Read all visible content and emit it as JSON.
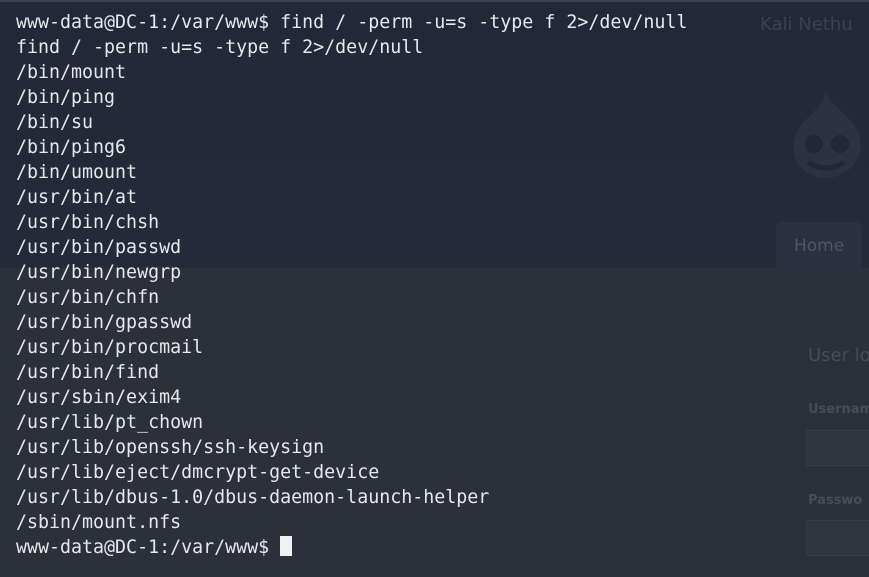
{
  "background": {
    "site_title": "Kali Nethu",
    "tab_label": "Home",
    "login_heading": "User lo",
    "username_label": "Usernam",
    "password_label": "Passwo"
  },
  "terminal": {
    "prompt": "www-data@DC-1:/var/www$ ",
    "command": "find / -perm -u=s -type f 2>/dev/null",
    "echo": "find / -perm -u=s -type f 2>/dev/null",
    "output": [
      "/bin/mount",
      "/bin/ping",
      "/bin/su",
      "/bin/ping6",
      "/bin/umount",
      "/usr/bin/at",
      "/usr/bin/chsh",
      "/usr/bin/passwd",
      "/usr/bin/newgrp",
      "/usr/bin/chfn",
      "/usr/bin/gpasswd",
      "/usr/bin/procmail",
      "/usr/bin/find",
      "/usr/sbin/exim4",
      "/usr/lib/pt_chown",
      "/usr/lib/openssh/ssh-keysign",
      "/usr/lib/eject/dmcrypt-get-device",
      "/usr/lib/dbus-1.0/dbus-daemon-launch-helper",
      "/sbin/mount.nfs"
    ],
    "final_prompt": "www-data@DC-1:/var/www$ "
  }
}
